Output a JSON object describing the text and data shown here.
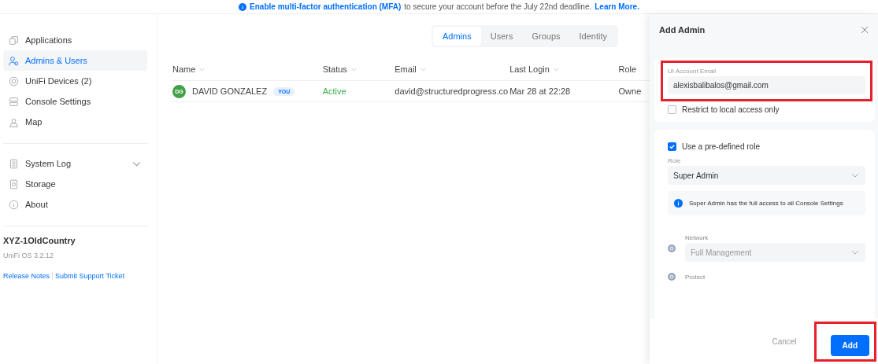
{
  "banner": {
    "text": "Enable multi-factor authentication (MFA)",
    "rest": "to secure your account before the July 22nd deadline.",
    "link": "Learn More."
  },
  "sidebar": {
    "items": [
      {
        "label": "Applications",
        "selected": false
      },
      {
        "label": "Admins & Users",
        "selected": true
      },
      {
        "label": "UniFi Devices (2)",
        "selected": false
      },
      {
        "label": "Console Settings",
        "selected": false
      },
      {
        "label": "Map",
        "selected": false
      }
    ],
    "secondary": [
      {
        "label": "System Log",
        "selected": false,
        "expandable": true
      },
      {
        "label": "Storage",
        "selected": false,
        "expandable": false
      },
      {
        "label": "About",
        "selected": false,
        "expandable": false
      }
    ],
    "console_name": "XYZ-1OldCountry",
    "version": "UniFi OS 3.2.12",
    "links": [
      "Release Notes",
      "Submit Support Ticket"
    ]
  },
  "tabs": [
    {
      "label": "Admins",
      "selected": true
    },
    {
      "label": "Users",
      "selected": false
    },
    {
      "label": "Groups",
      "selected": false
    },
    {
      "label": "Identity",
      "selected": false
    }
  ],
  "table": {
    "columns": [
      "Name",
      "Status",
      "Email",
      "Last Login",
      "Role"
    ],
    "rows": [
      {
        "initials": "DG",
        "name": "DAVID GONZALEZ",
        "badge": "YOU",
        "status": "Active",
        "email": "david@structuredprogress.co",
        "last_login": "Mar 28 at 22:28",
        "role": "Owne"
      }
    ]
  },
  "panel": {
    "title": "Add Admin",
    "email": {
      "label": "UI Account Email",
      "value": "alexisbalibalos@gmail.com",
      "highlighted": true
    },
    "restrict": {
      "label": "Restrict to local access only",
      "checked": false
    },
    "predefined": {
      "label": "Use a pre-defined role",
      "checked": true
    },
    "role": {
      "label": "Role",
      "value": "Super Admin"
    },
    "info": "Super Admin has the full access to all Console Settings",
    "permissions": [
      {
        "app": "Network",
        "value": "Full Management"
      },
      {
        "app": "Protect"
      }
    ],
    "buttons": [
      {
        "label": "Cancel",
        "kind": "text"
      },
      {
        "label": "Add",
        "kind": "primary",
        "highlighted": true
      }
    ]
  }
}
